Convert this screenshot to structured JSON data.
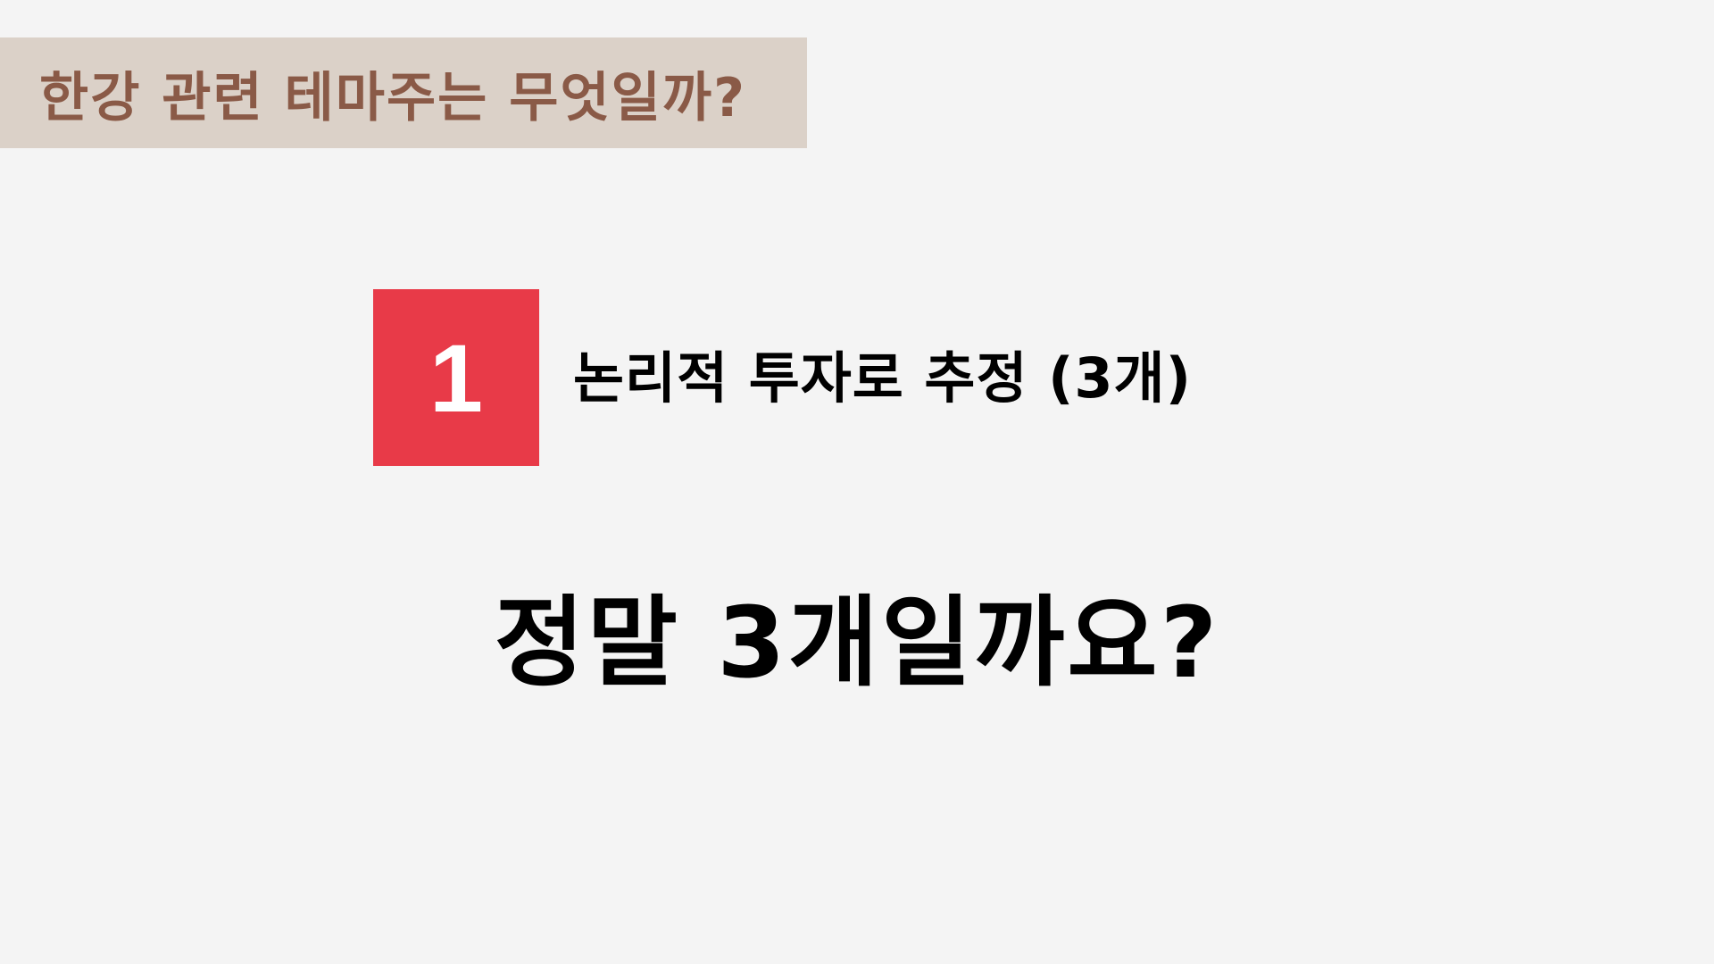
{
  "header": {
    "title": "한강 관련 테마주는 무엇일까?"
  },
  "item": {
    "number": "1",
    "label": "논리적 투자로 추정 (3개)"
  },
  "question": {
    "text": "정말 3개일까요?"
  },
  "colors": {
    "background": "#f4f4f4",
    "title_bar": "#dbd1c8",
    "title_text": "#8a5a47",
    "badge": "#e83a48",
    "badge_text": "#ffffff",
    "body_text": "#000000"
  }
}
